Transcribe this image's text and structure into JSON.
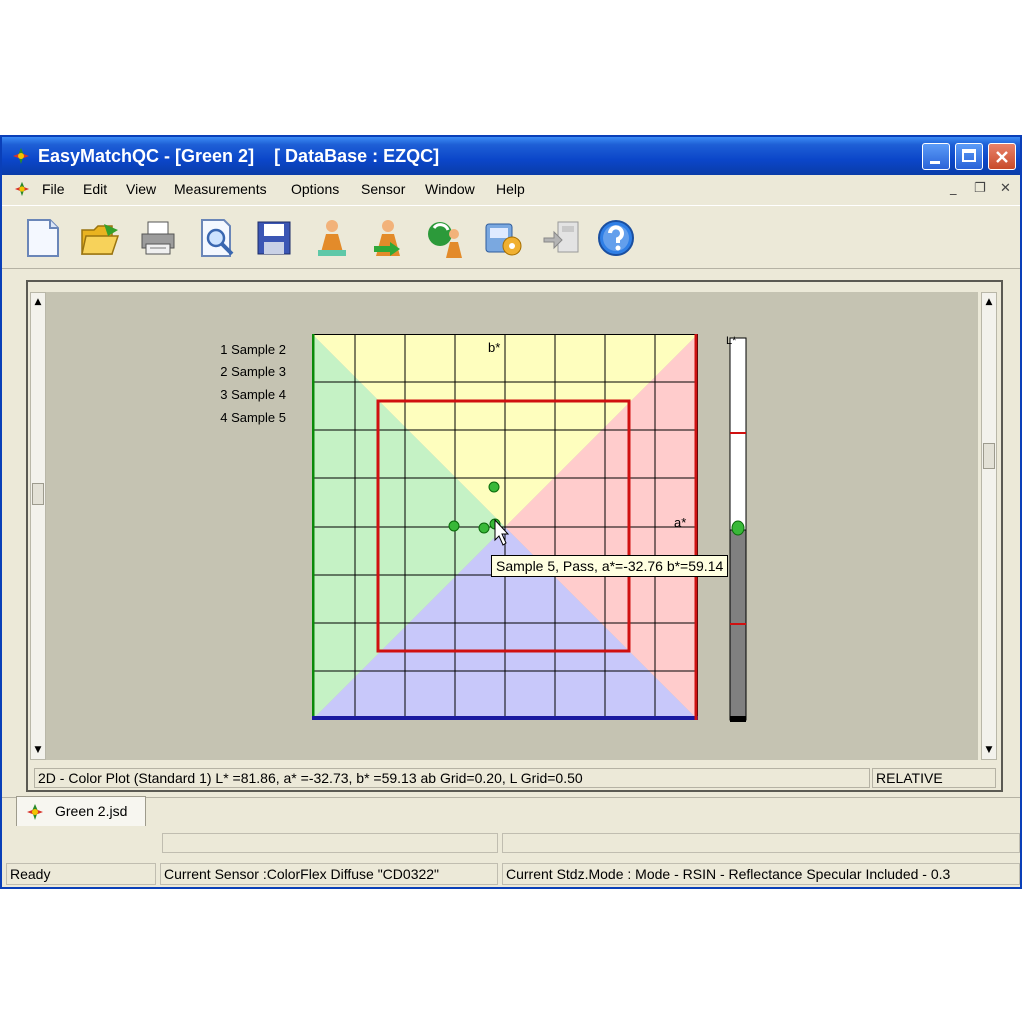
{
  "window": {
    "title": "EasyMatchQC - [Green 2]    [ DataBase : EZQC]"
  },
  "menu": {
    "items": [
      "File",
      "Edit",
      "View",
      "Measurements",
      "Options",
      "Sensor",
      "Window",
      "Help"
    ],
    "mdi_minimize": "_",
    "mdi_restore": "❐",
    "mdi_close": "✕"
  },
  "toolbar": {
    "icons": [
      "new-document-icon",
      "open-folder-icon",
      "print-icon",
      "print-preview-icon",
      "save-disk-icon",
      "measure-standard-icon",
      "measure-sample-icon",
      "standardize-icon",
      "sensor-setup-icon",
      "export-icon",
      "help-icon"
    ]
  },
  "plot": {
    "legend": [
      "1 Sample 2",
      "2 Sample 3",
      "3 Sample 4",
      "4 Sample 5"
    ],
    "axis_b_label": "b*",
    "axis_a_label": "a*",
    "axis_L_label": "L*",
    "tooltip": "Sample 5, Pass, a*=-32.76 b*=59.14"
  },
  "chart_data": {
    "type": "scatter",
    "x": [
      -32.76
    ],
    "y": [
      59.14
    ],
    "xlabel": "a*",
    "ylabel": "b*",
    "grid": true
  },
  "child_status": {
    "description": "2D - Color Plot (Standard 1) L* =81.86, a* =-32.73, b* =59.13    ab Grid=0.20, L Grid=0.50",
    "mode": "RELATIVE"
  },
  "doc_tab": {
    "label": "Green 2.jsd"
  },
  "statusbar": {
    "ready": "Ready",
    "sensor": "Current Sensor :ColorFlex Diffuse \"CD0322\"",
    "stdz": "Current Stdz.Mode :  Mode - RSIN - Reflectance Specular Included - 0.3"
  }
}
